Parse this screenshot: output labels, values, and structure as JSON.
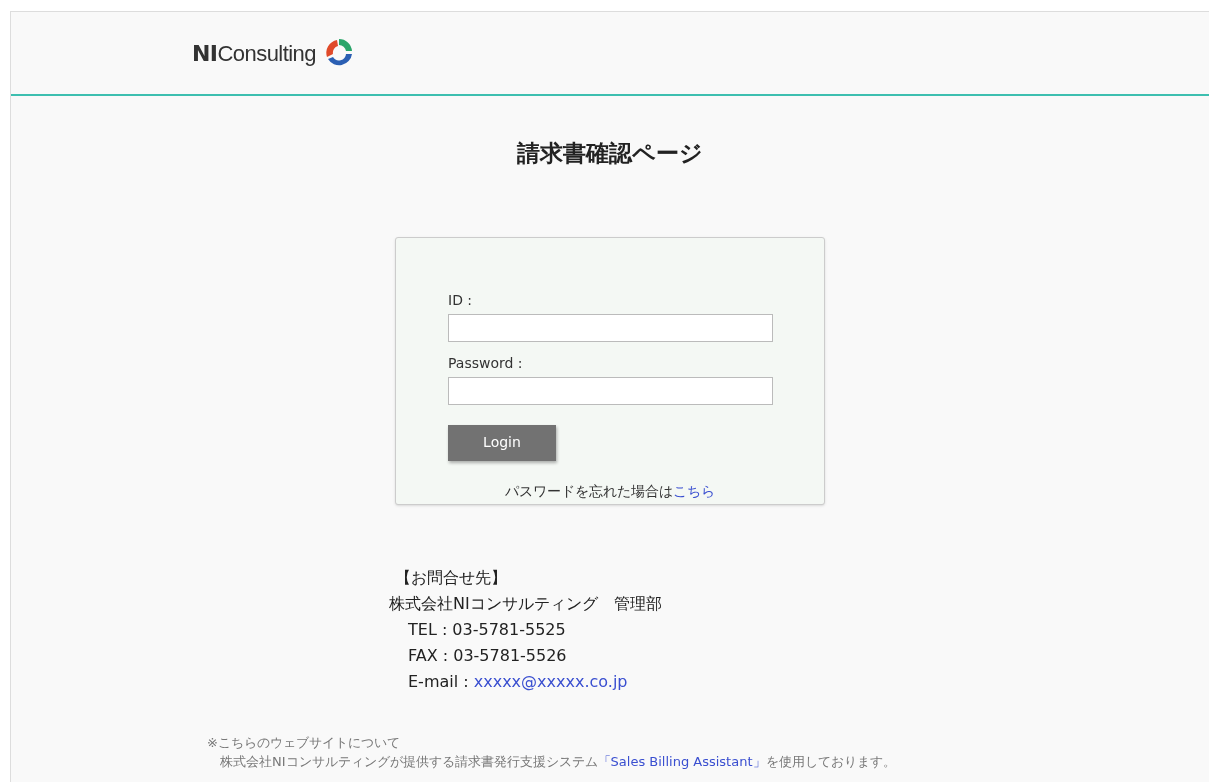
{
  "header": {
    "logo_bold": "NI",
    "logo_text": "Consulting"
  },
  "title": "請求書確認ページ",
  "login": {
    "fields": [
      {
        "label": "ID :"
      },
      {
        "label": "Password :"
      }
    ],
    "button": "Login",
    "forgot": {
      "text": "パスワードを忘れた場合は",
      "link": "こちら"
    }
  },
  "contact": {
    "heading": "【お問合せ先】",
    "company": "株式会社NIコンサルティング　管理部",
    "lines": [
      {
        "label": "TEL : ",
        "value": "03-5781-5525",
        "kind": "text"
      },
      {
        "label": "FAX : ",
        "value": "03-5781-5526",
        "kind": "text"
      },
      {
        "label": "E-mail : ",
        "value": "xxxxx@xxxxx.co.jp",
        "kind": "link"
      }
    ]
  },
  "note": {
    "heading": "※こちらのウェブサイトについて",
    "before": "株式会社NIコンサルティングが提供する請求書発行支援システム",
    "link": "「Sales Billing Assistant」",
    "after": "を使用しております。"
  }
}
